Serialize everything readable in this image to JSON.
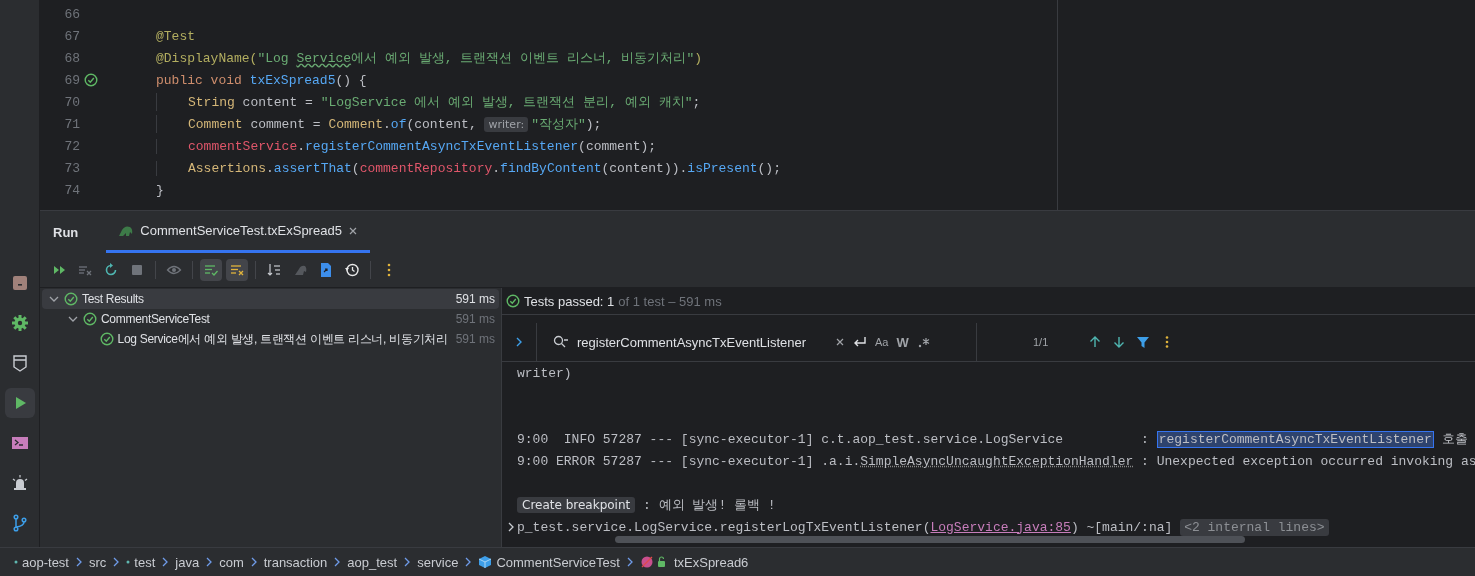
{
  "tool_strip": [
    {
      "selected": false
    },
    {
      "selected": false
    },
    {
      "selected": false
    },
    {
      "selected": true
    },
    {
      "selected": false
    },
    {
      "selected": false
    },
    {
      "selected": false
    }
  ],
  "editor": {
    "lines": [
      {
        "number": "66",
        "kind": "member"
      },
      {
        "number": "67",
        "kind": "member",
        "tokens": [
          {
            "kind": "annotation",
            "text": "@Test"
          }
        ]
      },
      {
        "number": "68",
        "kind": "member",
        "tokens": [
          {
            "kind": "annotation",
            "text": "@DisplayName("
          },
          {
            "kind": "string",
            "text": "\"Log "
          },
          {
            "kind": "string",
            "text": "Service",
            "typo": true
          },
          {
            "kind": "string",
            "text": "에서 예외 발생, 트랜잭션 이벤트 리스너, 비동기처리\""
          },
          {
            "kind": "annotation",
            "text": ")"
          }
        ]
      },
      {
        "number": "69",
        "kind": "member",
        "test_passed": true,
        "tokens": [
          {
            "kind": "keyword",
            "text": "public void "
          },
          {
            "kind": "declaration",
            "text": "txExSpread5"
          },
          {
            "kind": "plain",
            "text": "() {"
          }
        ]
      },
      {
        "number": "70",
        "kind": "body",
        "tokens": [
          {
            "kind": "type",
            "text": "String"
          },
          {
            "kind": "plain",
            "text": " content = "
          },
          {
            "kind": "string",
            "text": "\"LogService 에서 예외 발생, 트랜잭션 분리, 예외 캐치\""
          },
          {
            "kind": "plain",
            "text": ";"
          }
        ]
      },
      {
        "number": "71",
        "kind": "body",
        "tokens": [
          {
            "kind": "type",
            "text": "Comment"
          },
          {
            "kind": "plain",
            "text": " comment = "
          },
          {
            "kind": "type",
            "text": "Comment"
          },
          {
            "kind": "plain",
            "text": "."
          },
          {
            "kind": "call",
            "text": "of"
          },
          {
            "kind": "plain",
            "text": "(content, "
          },
          {
            "kind": "hint",
            "text": "writer:"
          },
          {
            "kind": "string",
            "text": "\"작성자\""
          },
          {
            "kind": "plain",
            "text": ");"
          }
        ]
      },
      {
        "number": "72",
        "kind": "body",
        "tokens": [
          {
            "kind": "field",
            "text": "commentService"
          },
          {
            "kind": "plain",
            "text": "."
          },
          {
            "kind": "call",
            "text": "registerCommentAsyncTxEventListener"
          },
          {
            "kind": "plain",
            "text": "(comment);"
          }
        ]
      },
      {
        "number": "73",
        "kind": "body",
        "tokens": [
          {
            "kind": "type",
            "text": "Assertions"
          },
          {
            "kind": "plain",
            "text": "."
          },
          {
            "kind": "call",
            "text": "assertThat"
          },
          {
            "kind": "plain",
            "text": "("
          },
          {
            "kind": "field",
            "text": "commentRepository"
          },
          {
            "kind": "plain",
            "text": "."
          },
          {
            "kind": "call",
            "text": "findByContent"
          },
          {
            "kind": "plain",
            "text": "(content))."
          },
          {
            "kind": "call",
            "text": "isPresent"
          },
          {
            "kind": "plain",
            "text": "();"
          }
        ]
      },
      {
        "number": "74",
        "kind": "member",
        "tokens": [
          {
            "kind": "plain",
            "text": "}"
          }
        ]
      }
    ]
  },
  "run": {
    "title": "Run",
    "tabs": [
      {
        "label": "CommentServiceTest.txExSpread5",
        "selected": true
      }
    ],
    "toolbar": [
      {
        "on": false
      },
      {
        "on": false
      },
      {
        "on": false
      },
      {
        "on": false
      },
      {
        "on": false
      },
      {
        "on": true
      },
      {
        "on": true
      },
      {
        "on": false
      },
      {
        "on": false
      },
      {
        "on": false
      },
      {
        "on": false
      },
      {
        "on": false
      }
    ],
    "tree": [
      {
        "label": "Test Results",
        "time": "591 ms",
        "selected": true,
        "expanded": true,
        "children": [
          {
            "label": "CommentServiceTest",
            "time": "591 ms",
            "selected": false,
            "expanded": true,
            "children": [
              {
                "label": "Log Service에서 예외 발생, 트랜잭션 이벤트 리스너, 비동기처리",
                "time": "591 ms",
                "selected": false
              }
            ]
          }
        ]
      }
    ],
    "status": {
      "passed": "Tests passed: 1",
      "summary": "of 1 test – 591 ms"
    },
    "search": {
      "value": "registerCommentAsyncTxEventListener",
      "match_case": "Aa",
      "words": "W",
      "count": "1/1"
    },
    "console": [
      {
        "kind": "text",
        "segments": [
          {
            "kind": "plain",
            "text": "writer)"
          }
        ]
      },
      {
        "kind": "blank"
      },
      {
        "kind": "blank"
      },
      {
        "kind": "text",
        "segments": [
          {
            "kind": "plain",
            "text": "9:00  INFO 57287 --- [sync-executor-1] c.t.aop_test.service.LogService          : "
          },
          {
            "kind": "match",
            "text": "registerCommentAsyncTxEventListener"
          },
          {
            "kind": "plain",
            "text": " 호출"
          }
        ]
      },
      {
        "kind": "text",
        "segments": [
          {
            "kind": "plain",
            "text": "9:00 ERROR 57287 --- [sync-executor-1] .a.i."
          },
          {
            "kind": "class",
            "text": "SimpleAsyncUncaughtExceptionHandler"
          },
          {
            "kind": "plain",
            "text": " : Unexpected exception occurred invoking as"
          }
        ]
      },
      {
        "kind": "blank"
      },
      {
        "kind": "text",
        "segments": [
          {
            "kind": "tooltip",
            "text": "Create breakpoint"
          },
          {
            "kind": "plain",
            "text": " : 예외 발생! 롤백 !"
          }
        ]
      },
      {
        "kind": "text",
        "expandable": true,
        "segments": [
          {
            "kind": "plain",
            "text": "p_test.service.LogService.registerLogTxEventListener("
          },
          {
            "kind": "link",
            "text": "LogService.java:85"
          },
          {
            "kind": "plain",
            "text": ") ~[main/:na] "
          },
          {
            "kind": "folded",
            "text": "<2 internal lines>"
          }
        ]
      }
    ]
  },
  "breadcrumb": [
    {
      "kind": "module",
      "label": "aop-test"
    },
    {
      "kind": "folder",
      "label": "src"
    },
    {
      "kind": "module",
      "label": "test"
    },
    {
      "kind": "folder",
      "label": "java"
    },
    {
      "kind": "folder",
      "label": "com"
    },
    {
      "kind": "folder",
      "label": "transaction"
    },
    {
      "kind": "folder",
      "label": "aop_test"
    },
    {
      "kind": "folder",
      "label": "service"
    },
    {
      "kind": "class",
      "label": "CommentServiceTest"
    },
    {
      "kind": "method",
      "label": "txExSpread6"
    }
  ]
}
